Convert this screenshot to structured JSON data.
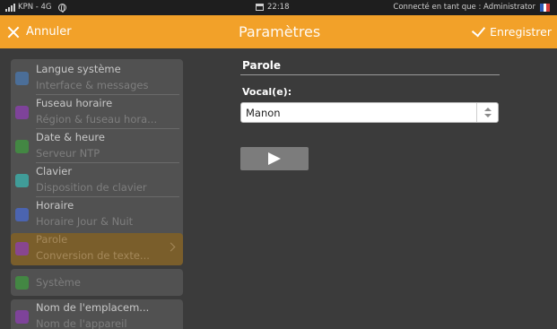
{
  "statusbar": {
    "carrier": "KPN - 4G",
    "time": "22:18",
    "user_text": "Connecté en tant que : Administrator",
    "flag_colors": [
      "#2f5db8",
      "#ffffff",
      "#d83b3b"
    ]
  },
  "header": {
    "cancel_label": "Annuler",
    "title": "Paramètres",
    "save_label": "Enregistrer",
    "background": "#f2a129"
  },
  "sidebar": {
    "items": [
      {
        "label": "Langue système",
        "sub": "Interface & messages",
        "icon": "globe-language-icon",
        "color": "#4a78b0"
      },
      {
        "label": "Fuseau horaire",
        "sub": "Région & fuseau hora...",
        "icon": "timezone-icon",
        "color": "#8e3fb3"
      },
      {
        "label": "Date & heure",
        "sub": "Serveur NTP",
        "icon": "clock-icon",
        "color": "#3f9a3f"
      },
      {
        "label": "Clavier",
        "sub": "Disposition de clavier",
        "icon": "keyboard-icon",
        "color": "#3bb6b0"
      },
      {
        "label": "Horaire",
        "sub": "Horaire Jour & Nuit",
        "icon": "sun-icon",
        "color": "#4a6bd0"
      },
      {
        "label": "Parole",
        "sub": "Conversion de texte...",
        "icon": "speech-icon",
        "color": "#8e3fb3"
      },
      {
        "label": "Système",
        "sub": "",
        "icon": "system-gear-icon",
        "color": "#3f9a3f"
      },
      {
        "label": "Nom de l'emplacem...",
        "sub": "Nom de l'appareil",
        "icon": "location-pin-icon",
        "color": "#8e3fb3"
      }
    ]
  },
  "panel": {
    "heading": "Parole",
    "voice_label": "Vocal(e):",
    "voice_value": "Manon"
  }
}
